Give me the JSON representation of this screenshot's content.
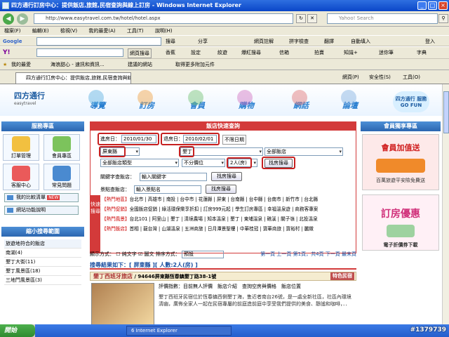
{
  "browser": {
    "window_title": "四方通行訂房中心：提供飯店,旅館,民宿查詢與線上訂房 - Windows Internet Explorer",
    "url": "http://www.easytravel.com.tw/hotel/hotel.aspx",
    "search_placeholder": "Yahoo! Search",
    "menu": [
      "檔案(F)",
      "編輯(E)",
      "檢視(V)",
      "我的最愛(A)",
      "工具(T)",
      "說明(H)"
    ],
    "google_label": "Google",
    "google_items": [
      "搜尋",
      "分享",
      "網頁註解",
      "拼字檢查",
      "翻譯",
      "自動填入",
      "登入"
    ],
    "yahoo_label": "Y!",
    "yahoo_items": [
      "網頁搜尋",
      "香蕉",
      "設定",
      "紋遊",
      "爆紅搜尋",
      "信箱",
      "拍賣",
      "知識+",
      "迷你筆",
      "字典"
    ],
    "fav_items": [
      "我的最愛",
      "海浪甜心 - 速訊和資訊...",
      "建議的網站",
      "取得更多附加元件"
    ],
    "tab_title": "四方通行訂房中心：提供飯店,旅館,民宿查詢與線...",
    "tab_tools": [
      "網頁(P)",
      "安全性(S)",
      "工具(O)"
    ],
    "taskbar_item": "6 Internet Explorer",
    "start": "開始",
    "watermark": "#1379739"
  },
  "site": {
    "logo": "四方通行",
    "logo_sub": "easytravel",
    "nav": [
      "導覽",
      "訂房",
      "會員",
      "購物",
      "網話",
      "論壇"
    ],
    "gofun": "四方通行 服務GO FUN"
  },
  "left": {
    "service_title": "服務專區",
    "icons": [
      "訂單管理",
      "會員專區",
      "客服中心",
      "常見問題"
    ],
    "compare": "我的比較清單",
    "compare_badge": "NEW",
    "guide": "網站功能說明",
    "area_title": "縮小搜尋範圍",
    "areas": [
      "旅遊地符合的飯店",
      "南湖(4)",
      "墾丁大街(11)",
      "墾丁風景區(18)",
      "三地門風景區(3)"
    ]
  },
  "query": {
    "title": "飯店快速查詢",
    "checkin_label": "進房日：",
    "checkin": "2010/01/30",
    "checkout_label": "退房日：",
    "checkout": "2010/02/01",
    "no_date": "不限日期",
    "county": "屏東縣",
    "area": "墾丁",
    "hotel_type_all": "全部飯店",
    "sel_type": "全部飯店類型",
    "sel_price": "不分價位",
    "sel_people": "2人(房)",
    "search_btn": "找房搜尋",
    "keyword_label": "關鍵字查飯店：",
    "keyword_value": "輸入關鍵字",
    "keyword_btn": "找房搜尋",
    "scene_label": "景點查飯店：",
    "scene_value": "輸入景點名",
    "scene_btn": "找房搜尋",
    "hot_side": "快速搜尋",
    "hot_rows": [
      {
        "tag": "【熱門地區】",
        "text": "台北市 | 高雄市 | 南投 | 台中市 | 花蓮縣 | 屏東 | 台南縣 | 台中縣 | 台南市 | 新竹市 | 台北縣"
      },
      {
        "tag": "【熱門促銷】",
        "text": "全國飯店促銷 | 綠活環保樂享折扣 | 訂房999元起 | 學生訂房專區 | 幸福溫泉遊 | 商務客專案"
      },
      {
        "tag": "【熱門風景】",
        "text": "台北101 | 阿里山 | 墾丁 | 清境農場 | 知本溫泉 | 墾丁 | 東埔溫泉 | 礁溪 | 關子嶺 | 北投溫泉"
      },
      {
        "tag": "【熱門飯店】",
        "text": "首相 | 龍台灣 | 山湖溫泉 | 五洲商旅 | 日月潭景聖樓 | 中華桂冠 | 寶華商旅 | 寶裕村 | 麗緻"
      }
    ],
    "display_label": "顯示方式：",
    "display_text": "純文字",
    "display_img": "圖文",
    "sort_label": "排序方式：",
    "sort_value": "預設",
    "pager": "第一頁 上一頁 第1頁，共4頁 下一頁 最末頁"
  },
  "results": {
    "title": "搜尋結果如下：[ 屏東縣 ][ 人數:2人(房) ]",
    "hotel_name": "墾丁西班牙旅店",
    "hotel_info": "/ 94646屏東縣恆春鎮墾丁路38-1號",
    "badge": "特色民宿",
    "links": "評價指數：目前無人評價　飯店介紹　查詢空房與價格　飯店位置",
    "desc": "墾丁西班牙民宿位於恆春鎮西側墾丁海，隻近者南台26號，是一處全新社區，社區內環境清幽，廣佈全家人一起在民宿專屬的前庭造前庭中享受我們提供的美食、靜謐和咖啡，．．"
  },
  "right": {
    "title": "會員獨享專區",
    "ad1_title": "會員加值送",
    "ad1_sub": "百萬旅遊平安險免費送",
    "ad2_title": "訂房優惠",
    "ad2_sub": "電子折價券下載"
  },
  "colors": {
    "accent": "#d33a3a",
    "nav_blue": "#2a7fd0",
    "xp_blue": "#245ecc"
  }
}
